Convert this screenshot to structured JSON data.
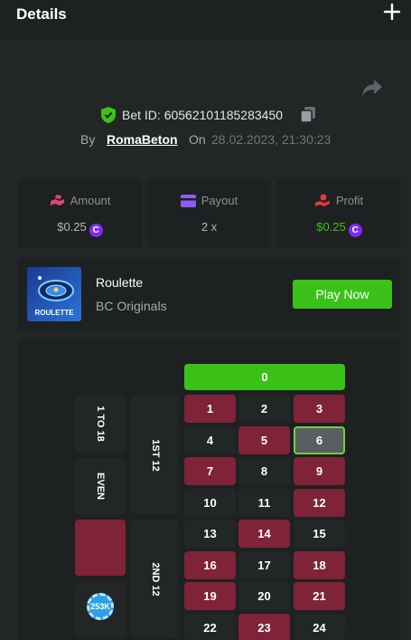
{
  "header": {
    "title": "Details",
    "close_icon": "plus-icon"
  },
  "bet": {
    "label": "Bet ID:",
    "id": "60562101185283450",
    "by_label": "By",
    "user": "RomaBeton",
    "on_label": "On",
    "date": "28.02.2023, 21:30:23"
  },
  "stats": {
    "amount": {
      "label": "Amount",
      "value": "$0.25",
      "coin": "C",
      "icon": "hand-money-icon",
      "color": "#e0456c"
    },
    "payout": {
      "label": "Payout",
      "value": "2 x",
      "icon": "wallet-icon",
      "color": "#8d5cf5"
    },
    "profit": {
      "label": "Profit",
      "value": "$0.25",
      "coin": "C",
      "icon": "hand-coin-icon",
      "color": "#e03a3a"
    }
  },
  "game": {
    "name": "Roulette",
    "provider": "BC Originals",
    "thumb_label": "ROULETTE",
    "play_label": "Play Now"
  },
  "board": {
    "zero": "0",
    "numbers": [
      {
        "n": "1",
        "color": "red"
      },
      {
        "n": "2",
        "color": "black"
      },
      {
        "n": "3",
        "color": "red"
      },
      {
        "n": "4",
        "color": "black"
      },
      {
        "n": "5",
        "color": "red"
      },
      {
        "n": "6",
        "color": "black",
        "selected": true
      },
      {
        "n": "7",
        "color": "red"
      },
      {
        "n": "8",
        "color": "black"
      },
      {
        "n": "9",
        "color": "red"
      },
      {
        "n": "10",
        "color": "black"
      },
      {
        "n": "11",
        "color": "black"
      },
      {
        "n": "12",
        "color": "red"
      },
      {
        "n": "13",
        "color": "black"
      },
      {
        "n": "14",
        "color": "red"
      },
      {
        "n": "15",
        "color": "black"
      },
      {
        "n": "16",
        "color": "red"
      },
      {
        "n": "17",
        "color": "black"
      },
      {
        "n": "18",
        "color": "red"
      },
      {
        "n": "19",
        "color": "red"
      },
      {
        "n": "20",
        "color": "black"
      },
      {
        "n": "21",
        "color": "red"
      },
      {
        "n": "22",
        "color": "black"
      },
      {
        "n": "23",
        "color": "red"
      },
      {
        "n": "24",
        "color": "black"
      }
    ],
    "dozens": {
      "first": "1ST 12",
      "second": "2ND 12"
    },
    "outside": {
      "low": "1 TO 18",
      "even": "EVEN"
    },
    "chip_label": "253K"
  },
  "colors": {
    "accent": "#3bc117",
    "red": "#7f2338",
    "black": "#232626",
    "bg": "#232626",
    "panel": "#1e2121"
  }
}
